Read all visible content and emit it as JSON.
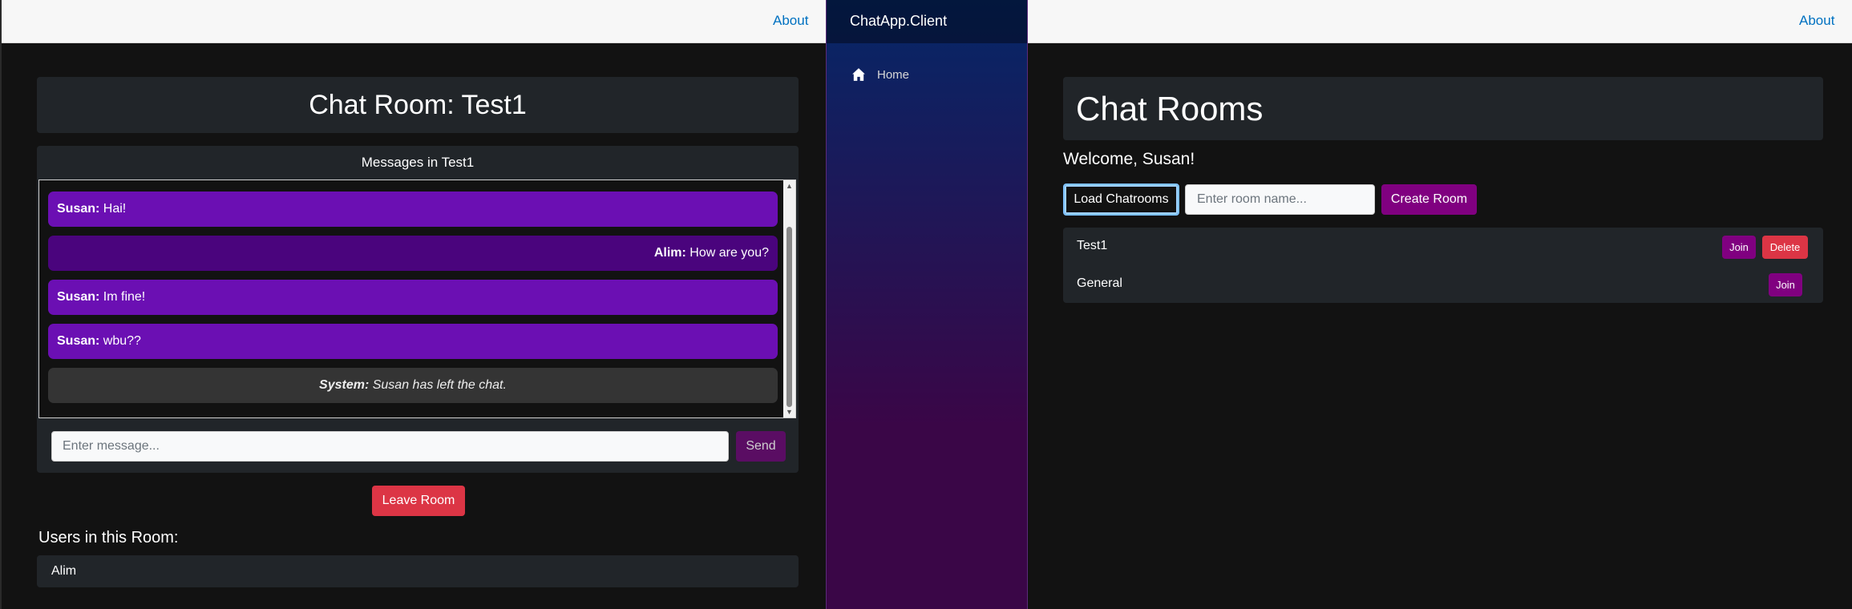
{
  "left": {
    "about_label": "About",
    "room_title": "Chat Room: Test1",
    "messages_header": "Messages in Test1",
    "messages": [
      {
        "sender": "Susan:",
        "text": " Hai!",
        "kind": "self"
      },
      {
        "sender": "Alim:",
        "text": " How are you?",
        "kind": "other"
      },
      {
        "sender": "Susan:",
        "text": " Im fine!",
        "kind": "self"
      },
      {
        "sender": "Susan:",
        "text": " wbu??",
        "kind": "self"
      },
      {
        "sender": "System:",
        "text": " Susan has left the chat.",
        "kind": "system"
      }
    ],
    "message_placeholder": "Enter message...",
    "send_label": "Send",
    "leave_label": "Leave Room",
    "users_heading": "Users in this Room:",
    "users": [
      "Alim"
    ]
  },
  "sidebar": {
    "brand": "ChatApp.Client",
    "nav_home": "Home"
  },
  "right": {
    "about_label": "About",
    "page_title": "Chat Rooms",
    "welcome": "Welcome, Susan!",
    "load_label": "Load Chatrooms",
    "room_placeholder": "Enter room name...",
    "create_label": "Create Room",
    "rooms": [
      {
        "name": "Test1",
        "join_label": "Join",
        "delete_label": "Delete"
      },
      {
        "name": "General",
        "join_label": "Join"
      }
    ]
  },
  "colors": {
    "self_message": "#6b0fb3",
    "other_message": "#4a047d",
    "system_message": "#343434",
    "danger": "#dc3545",
    "purple": "#800080",
    "link": "#0071c1"
  }
}
